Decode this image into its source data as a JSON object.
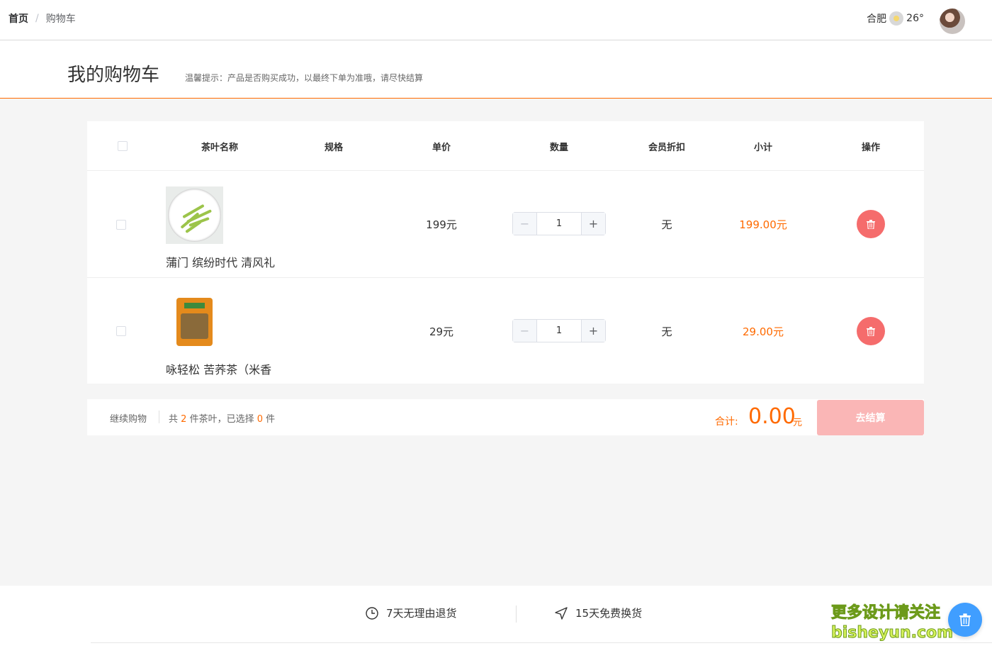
{
  "topbar": {
    "breadcrumb_home": "首页",
    "breadcrumb_sep": "/",
    "breadcrumb_current": "购物车",
    "city": "合肥",
    "temperature": "26°",
    "weather_icon": "sun-icon"
  },
  "header": {
    "title": "我的购物车",
    "tip": "温馨提示：产品是否购买成功，以最终下单为准哦，请尽快结算"
  },
  "table": {
    "columns": [
      "茶叶名称",
      "规格",
      "单价",
      "数量",
      "会员折扣",
      "小计",
      "操作"
    ],
    "rows": [
      {
        "name": "蒲门 缤纷时代 清风礼",
        "price": "199元",
        "quantity": "1",
        "discount": "无",
        "subtotal": "199.00元"
      },
      {
        "name": "咏轻松 苦荞茶（米香",
        "price": "29元",
        "quantity": "1",
        "discount": "无",
        "subtotal": "29.00元"
      }
    ]
  },
  "summary": {
    "continue_label": "继续购物",
    "count_prefix": "共",
    "total_count": "2",
    "count_mid": "件茶叶，已选择",
    "selected_count": "0",
    "count_suffix": "件",
    "total_label": "合计:",
    "total_value": "0.00",
    "total_unit": "元",
    "checkout_label": "去结算"
  },
  "services": {
    "return_label": "7天无理由退货",
    "exchange_label": "15天免费换货",
    "promo_line1": "更多设计请关注",
    "promo_line2": "bisheyun.com"
  },
  "colors": {
    "accent": "#ff6a00",
    "danger": "#f56c6c",
    "checkout_disabled": "#fab6b6",
    "fab": "#409eff"
  }
}
